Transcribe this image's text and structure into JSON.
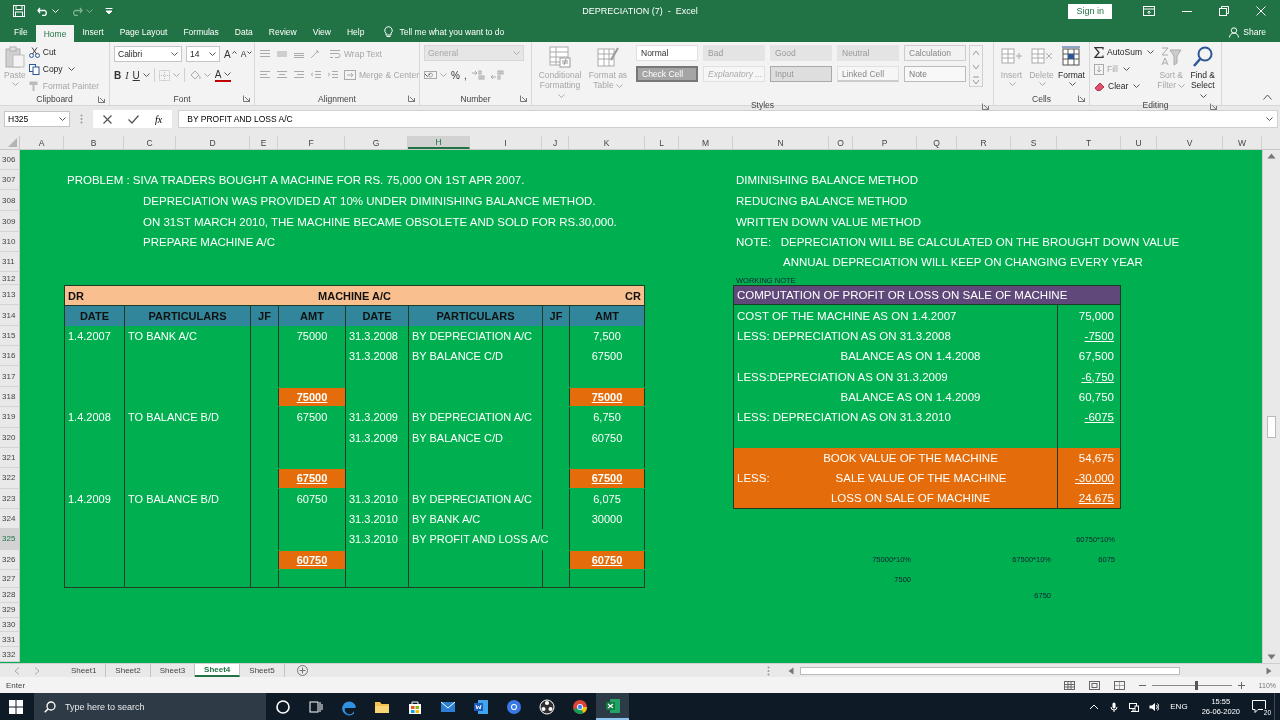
{
  "title_bar": {
    "title": "DEPRECIATION (7)  -  Excel",
    "sign_in": "Sign in"
  },
  "ribbon_tabs": [
    {
      "label": "File",
      "selected": false
    },
    {
      "label": "Home",
      "selected": true
    },
    {
      "label": "Insert",
      "selected": false
    },
    {
      "label": "Page Layout",
      "selected": false
    },
    {
      "label": "Formulas",
      "selected": false
    },
    {
      "label": "Data",
      "selected": false
    },
    {
      "label": "Review",
      "selected": false
    },
    {
      "label": "View",
      "selected": false
    },
    {
      "label": "Help",
      "selected": false
    }
  ],
  "tell_me": "Tell me what you want to do",
  "share": "Share",
  "ribbon": {
    "clipboard": {
      "label": "Clipboard",
      "paste": {
        "label": "Paste",
        "disabled": true
      },
      "cut": {
        "label": "Cut",
        "disabled": false
      },
      "copy": {
        "label": "Copy",
        "disabled": false
      },
      "format_painter": {
        "label": "Format Painter",
        "disabled": true
      }
    },
    "font": {
      "label": "Font",
      "family": "Calibri",
      "size": "14",
      "grow": "A",
      "shrink": "A",
      "bold": "B",
      "italic": "I",
      "underline": "U",
      "font_color": "A"
    },
    "alignment": {
      "label": "Alignment",
      "wrap_text": {
        "label": "Wrap Text",
        "disabled": true
      },
      "merge": {
        "label": "Merge & Center",
        "disabled": true
      }
    },
    "number": {
      "label": "Number",
      "format": {
        "label": "General",
        "disabled": true
      },
      "percent": "%",
      "comma": ","
    },
    "styles": {
      "label": "Styles",
      "conditional": {
        "label": "Conditional Formatting",
        "disabled": true
      },
      "format_table": {
        "label": "Format as Table",
        "disabled": true
      },
      "cell_styles": [
        {
          "label": "Normal",
          "kind": "normal"
        },
        {
          "label": "Bad",
          "kind": "bad"
        },
        {
          "label": "Good",
          "kind": "good"
        },
        {
          "label": "Neutral",
          "kind": "neutral"
        },
        {
          "label": "Calculation",
          "kind": "calculation"
        },
        {
          "label": "Check Cell",
          "kind": "check"
        },
        {
          "label": "Explanatory ...",
          "kind": "explanatory"
        },
        {
          "label": "Input",
          "kind": "input"
        },
        {
          "label": "Linked Cell",
          "kind": "linked"
        },
        {
          "label": "Note",
          "kind": "note"
        }
      ]
    },
    "cells": {
      "label": "Cells",
      "buttons": [
        {
          "label": "Insert",
          "kind": "insert",
          "disabled": true
        },
        {
          "label": "Delete",
          "kind": "delete",
          "disabled": true
        },
        {
          "label": "Format",
          "kind": "format",
          "disabled": false
        }
      ]
    },
    "editing": {
      "label": "Editing",
      "autosum": {
        "label": "AutoSum",
        "disabled": false
      },
      "fill": {
        "label": "Fill",
        "disabled": true
      },
      "clear": {
        "label": "Clear",
        "disabled": false
      },
      "sort": {
        "label": "Sort & Filter",
        "disabled": true
      },
      "find": {
        "label": "Find & Select",
        "disabled": false
      }
    }
  },
  "formula_bar": {
    "name_box": "H325",
    "fx": "fx",
    "formula": "BY PROFIT AND LOSS A/C"
  },
  "columns": [
    {
      "label": "A",
      "selected": false
    },
    {
      "label": "B",
      "selected": false
    },
    {
      "label": "C",
      "selected": false
    },
    {
      "label": "D",
      "selected": false
    },
    {
      "label": "E",
      "selected": false
    },
    {
      "label": "F",
      "selected": false
    },
    {
      "label": "G",
      "selected": false
    },
    {
      "label": "H",
      "selected": true
    },
    {
      "label": "I",
      "selected": false
    },
    {
      "label": "J",
      "selected": false
    },
    {
      "label": "K",
      "selected": false
    },
    {
      "label": "L",
      "selected": false
    },
    {
      "label": "M",
      "selected": false
    },
    {
      "label": "N",
      "selected": false
    },
    {
      "label": "O",
      "selected": false
    },
    {
      "label": "P",
      "selected": false
    },
    {
      "label": "Q",
      "selected": false
    },
    {
      "label": "R",
      "selected": false
    },
    {
      "label": "S",
      "selected": false
    },
    {
      "label": "T",
      "selected": false
    },
    {
      "label": "U",
      "selected": false
    },
    {
      "label": "V",
      "selected": false
    },
    {
      "label": "W",
      "selected": false
    }
  ],
  "rows": [
    {
      "label": "306",
      "selected": false
    },
    {
      "label": "307",
      "selected": false
    },
    {
      "label": "308",
      "selected": false
    },
    {
      "label": "309",
      "selected": false
    },
    {
      "label": "310",
      "selected": false
    },
    {
      "label": "311",
      "selected": false
    },
    {
      "label": "312",
      "selected": false
    },
    {
      "label": "313",
      "selected": false
    },
    {
      "label": "314",
      "selected": false
    },
    {
      "label": "315",
      "selected": false
    },
    {
      "label": "316",
      "selected": false
    },
    {
      "label": "317",
      "selected": false
    },
    {
      "label": "318",
      "selected": false
    },
    {
      "label": "319",
      "selected": false
    },
    {
      "label": "320",
      "selected": false
    },
    {
      "label": "321",
      "selected": false
    },
    {
      "label": "322",
      "selected": false
    },
    {
      "label": "323",
      "selected": false
    },
    {
      "label": "324",
      "selected": false
    },
    {
      "label": "325",
      "selected": true
    },
    {
      "label": "326",
      "selected": false
    },
    {
      "label": "327",
      "selected": false
    },
    {
      "label": "328",
      "selected": false
    },
    {
      "label": "329",
      "selected": false
    },
    {
      "label": "330",
      "selected": false
    },
    {
      "label": "331",
      "selected": false
    },
    {
      "label": "332",
      "selected": false
    }
  ],
  "problem": [
    {
      "text": "PROBLEM : SIVA TRADERS BOUGHT A MACHINE FOR RS. 75,000 ON 1ST APR 2007.",
      "indented": false
    },
    {
      "text": "DEPRECIATION WAS PROVIDED AT 10% UNDER DIMINISHING BALANCE METHOD.",
      "indented": true
    },
    {
      "text": "ON 31ST MARCH 2010, THE MACHINE BECAME OBSOLETE AND SOLD FOR RS.30,000.",
      "indented": true
    },
    {
      "text": "PREPARE MACHINE A/C",
      "indented": true
    }
  ],
  "method_notes": [
    {
      "text": "DIMINISHING BALANCE METHOD",
      "indented": false
    },
    {
      "text": "REDUCING BALANCE METHOD",
      "indented": false
    },
    {
      "text": "WRITTEN DOWN VALUE METHOD",
      "indented": false
    },
    {
      "text": "NOTE:   DEPRECIATION WILL BE CALCULATED ON THE BROUGHT DOWN VALUE",
      "indented": false
    },
    {
      "text": "ANNUAL DEPRECIATION WILL KEEP ON CHANGING EVERY YEAR",
      "indented": true
    }
  ],
  "working_note": "WORKING NOTE",
  "ledger": {
    "dr": "DR",
    "title": "MACHINE A/C",
    "cr": "CR",
    "columns": [
      "DATE",
      "PARTICULARS",
      "JF",
      "AMT",
      "DATE",
      "PARTICULARS",
      "JF",
      "AMT"
    ],
    "rows": [
      {
        "kind": "entry",
        "dr_date": "1.4.2007",
        "dr_particulars": "TO BANK A/C",
        "dr_amount": "75000",
        "cr_date": "31.3.2008",
        "cr_particulars": "BY DEPRECIATION A/C",
        "cr_amount": "7,500"
      },
      {
        "kind": "entry",
        "cr_date": "31.3.2008",
        "cr_particulars": "BY BALANCE C/D",
        "cr_amount": "67500"
      },
      {
        "kind": "blank"
      },
      {
        "kind": "total",
        "dr_amount": "75000",
        "cr_amount": "75000"
      },
      {
        "kind": "entry",
        "dr_date": "1.4.2008",
        "dr_particulars": "TO BALANCE B/D",
        "dr_amount": "67500",
        "cr_date": "31.3.2009",
        "cr_particulars": "BY DEPRECIATION A/C",
        "cr_amount": "6,750"
      },
      {
        "kind": "entry",
        "cr_date": "31.3.2009",
        "cr_particulars": "BY BALANCE C/D",
        "cr_amount": "60750"
      },
      {
        "kind": "blank"
      },
      {
        "kind": "total",
        "dr_amount": "67500",
        "cr_amount": "67500"
      },
      {
        "kind": "entry",
        "dr_date": "1.4.2009",
        "dr_particulars": "TO BALANCE B/D",
        "dr_amount": "60750",
        "cr_date": "31.3.2010",
        "cr_particulars": "BY DEPRECIATION A/C",
        "cr_amount": "6,075"
      },
      {
        "kind": "entry",
        "cr_date": "31.3.2010",
        "cr_particulars": "BY BANK A/C",
        "cr_amount": "30000"
      },
      {
        "kind": "entry",
        "cr_date": "31.3.2010",
        "cr_particulars": "BY PROFIT AND LOSS A/C"
      },
      {
        "kind": "total",
        "dr_amount": "60750",
        "cr_amount": "60750"
      },
      {
        "kind": "blank"
      }
    ]
  },
  "computation": {
    "title": "COMPUTATION OF PROFIT OR LOSS ON SALE OF MACHINE",
    "rows": [
      {
        "kind": "line",
        "label": "COST OF THE MACHINE AS ON 1.4.2007",
        "value": "75,000",
        "centered": false,
        "underlined": false,
        "highlight": false
      },
      {
        "kind": "line",
        "label": "LESS: DEPRECIATION AS ON 31.3.2008",
        "value": "-7500",
        "centered": false,
        "underlined": true,
        "highlight": false
      },
      {
        "kind": "line",
        "label": "BALANCE AS ON 1.4.2008",
        "value": "67,500",
        "centered": true,
        "underlined": false,
        "highlight": false
      },
      {
        "kind": "line",
        "label": "LESS:DEPRECIATION AS ON 31.3.2009",
        "value": "-6,750",
        "centered": false,
        "underlined": true,
        "highlight": false
      },
      {
        "kind": "line",
        "label": "BALANCE AS ON 1.4.2009",
        "value": "60,750",
        "centered": true,
        "underlined": false,
        "highlight": false
      },
      {
        "kind": "line",
        "label": "LESS: DEPRECIATION AS ON 31.3.2010",
        "value": "-6075",
        "centered": false,
        "underlined": true,
        "highlight": false
      },
      {
        "kind": "blank",
        "highlight": false
      },
      {
        "kind": "line",
        "label": "BOOK VALUE OF THE MACHINE",
        "value": "54,675",
        "centered": true,
        "underlined": false,
        "highlight": true
      },
      {
        "kind": "line",
        "prefix": "LESS:",
        "label": "SALE VALUE OF THE MACHINE",
        "value": "-30,000",
        "centered": true,
        "underlined": true,
        "highlight": true
      },
      {
        "kind": "line",
        "label": "LOSS ON SALE OF MACHINE",
        "value": "24,675",
        "centered": true,
        "underlined": true,
        "highlight": true
      }
    ]
  },
  "rough_work": [
    "60750*10%",
    "75000*10%",
    "67500*10%",
    "6075",
    "7500",
    "6750"
  ],
  "sheet_tabs": [
    {
      "label": "Sheet1",
      "selected": false
    },
    {
      "label": "Sheet2",
      "selected": false
    },
    {
      "label": "Sheet3",
      "selected": false
    },
    {
      "label": "Sheet4",
      "selected": true
    },
    {
      "label": "Sheet5",
      "selected": false
    }
  ],
  "status_bar": {
    "mode": "Enter",
    "zoom": {
      "label": "110%",
      "level": 0.55
    }
  },
  "taskbar": {
    "search_placeholder": "Type here to search",
    "apps": [
      {
        "kind": "cortana",
        "selected": false
      },
      {
        "kind": "taskview",
        "selected": false
      },
      {
        "kind": "edge",
        "selected": false
      },
      {
        "kind": "explorer",
        "selected": false
      },
      {
        "kind": "store",
        "selected": false
      },
      {
        "kind": "mail",
        "selected": false
      },
      {
        "kind": "word",
        "selected": false
      },
      {
        "kind": "globe",
        "selected": false
      },
      {
        "kind": "aperture",
        "selected": false
      },
      {
        "kind": "chrome",
        "selected": false
      },
      {
        "kind": "excel",
        "selected": true
      }
    ],
    "language": "ENG",
    "time": "15:55",
    "date": "26-06-2020",
    "notifications": "20"
  }
}
